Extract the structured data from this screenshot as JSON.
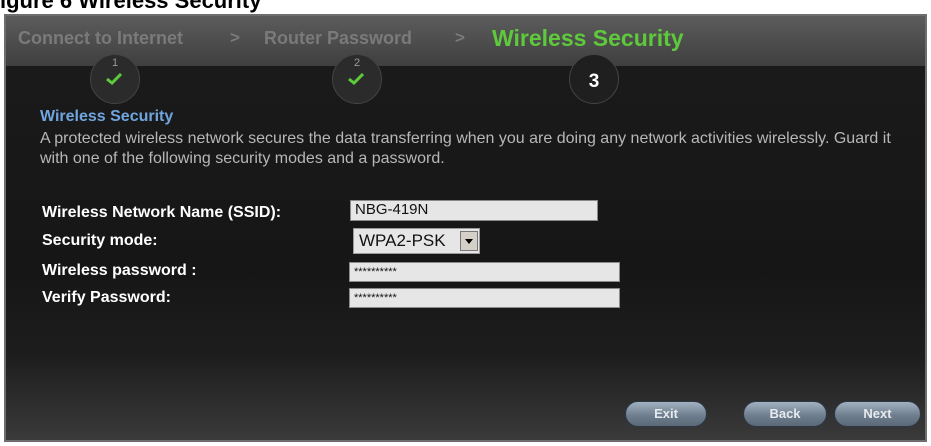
{
  "caption": "igure 6 Wireless Security",
  "steps": [
    {
      "label": "Connect to Internet",
      "number": "1",
      "status": "done"
    },
    {
      "label": "Router Password",
      "number": "2",
      "status": "done"
    },
    {
      "label": "Wireless Security",
      "number": "3",
      "status": "current"
    }
  ],
  "separator": ">",
  "section": {
    "title": "Wireless Security",
    "description": "A protected wireless network secures the data transferring when you are doing any network activities wirelessly. Guard it with one of the following security modes and a password."
  },
  "form": {
    "ssid_label": "Wireless Network Name (SSID):",
    "ssid_value": "NBG-419N",
    "mode_label": "Security mode:",
    "mode_value": "WPA2-PSK",
    "password_label": "Wireless password :",
    "password_value": "**********",
    "verify_label": "Verify Password:",
    "verify_value": "**********"
  },
  "buttons": {
    "exit": "Exit",
    "back": "Back",
    "next": "Next"
  },
  "colors": {
    "active_step": "#5ec93b",
    "section_title": "#6fa6df",
    "background": "#161616"
  },
  "icons": {
    "done_step": "checkmark-icon",
    "dropdown": "chevron-down-icon"
  }
}
